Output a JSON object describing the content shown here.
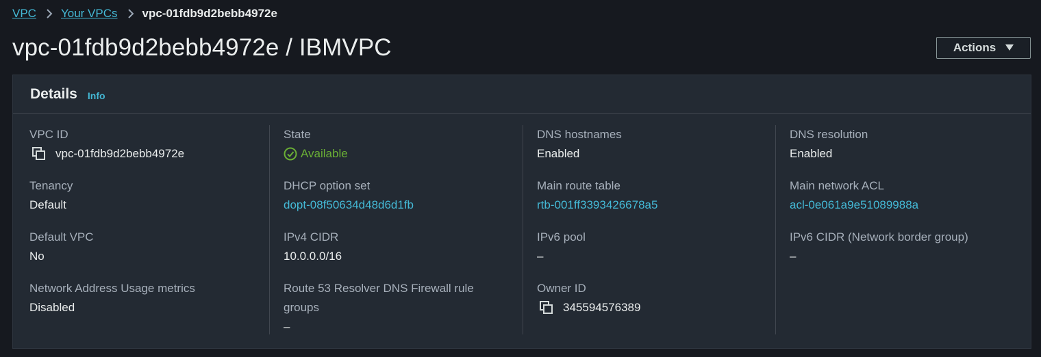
{
  "breadcrumb": {
    "items": [
      "VPC",
      "Your VPCs"
    ],
    "current": "vpc-01fdb9d2bebb4972e"
  },
  "title": "vpc-01fdb9d2bebb4972e / IBMVPC",
  "actions_label": "Actions",
  "panel": {
    "title": "Details",
    "info": "Info"
  },
  "columns": [
    {
      "fields": [
        {
          "label": "VPC ID",
          "value": "vpc-01fdb9d2bebb4972e"
        },
        {
          "label": "Tenancy",
          "value": "Default"
        },
        {
          "label": "Default VPC",
          "value": "No"
        },
        {
          "label": "Network Address Usage metrics",
          "value": "Disabled"
        }
      ]
    },
    {
      "fields": [
        {
          "label": "State",
          "value": "Available"
        },
        {
          "label": "DHCP option set",
          "value": "dopt-08f50634d48d6d1fb"
        },
        {
          "label": "IPv4 CIDR",
          "value": "10.0.0.0/16"
        },
        {
          "label": "Route 53 Resolver DNS Firewall rule groups",
          "value": "–"
        }
      ]
    },
    {
      "fields": [
        {
          "label": "DNS hostnames",
          "value": "Enabled"
        },
        {
          "label": "Main route table",
          "value": "rtb-001ff3393426678a5"
        },
        {
          "label": "IPv6 pool",
          "value": "–"
        },
        {
          "label": "Owner ID",
          "value": "345594576389"
        }
      ]
    },
    {
      "fields": [
        {
          "label": "DNS resolution",
          "value": "Enabled"
        },
        {
          "label": "Main network ACL",
          "value": "acl-0e061a9e51089988a"
        },
        {
          "label": "IPv6 CIDR (Network border group)",
          "value": "–"
        }
      ]
    }
  ],
  "colors": {
    "link": "#44b9d6",
    "available": "#6aaf35",
    "background": "#16191f",
    "panel": "#232a33"
  },
  "icons": [
    "chevron-right-icon",
    "caret-down-icon",
    "copy-icon",
    "check-circle-icon"
  ]
}
